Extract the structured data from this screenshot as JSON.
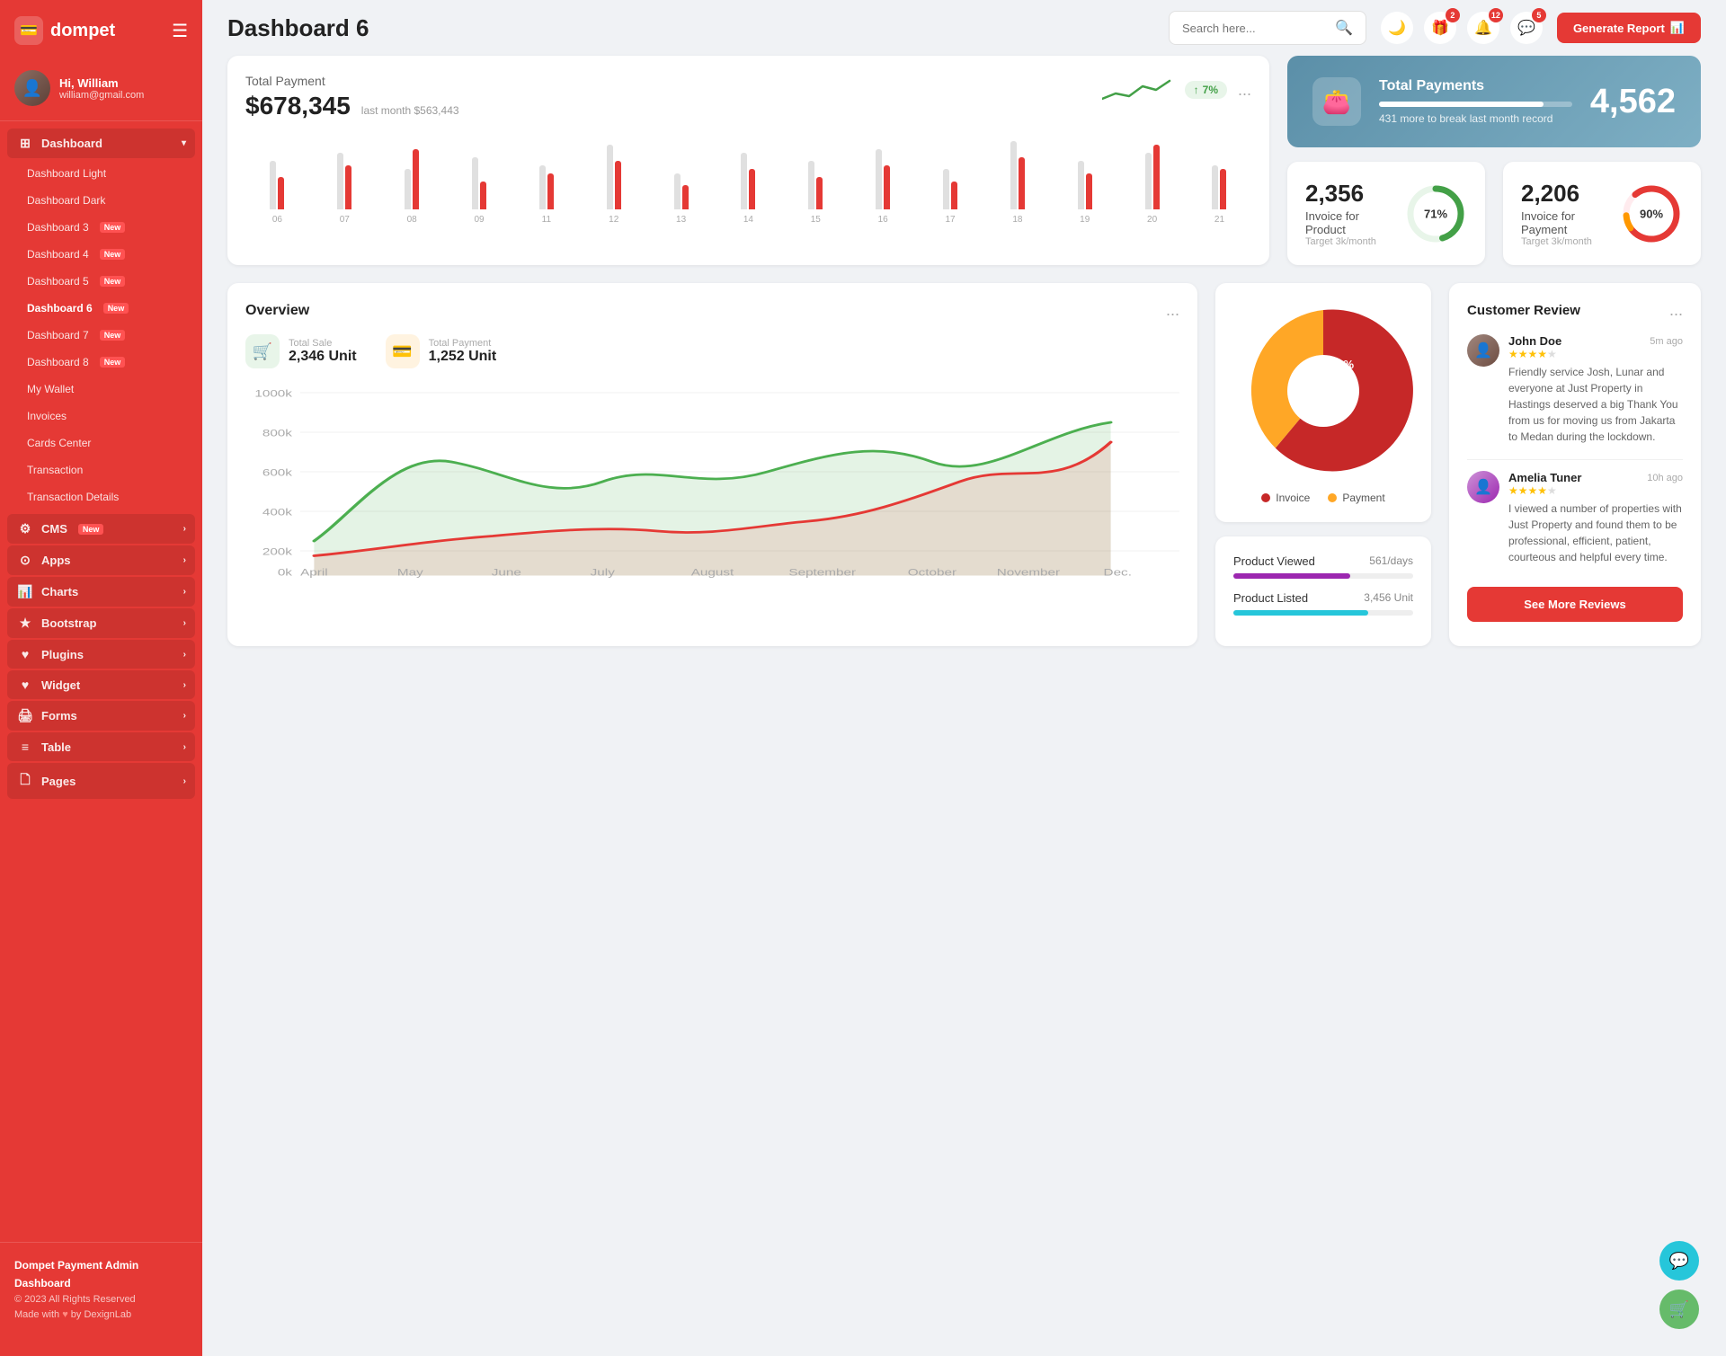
{
  "sidebar": {
    "logo": "dompet",
    "user": {
      "greeting": "Hi, William",
      "email": "william@gmail.com"
    },
    "nav": {
      "dashboard_label": "Dashboard",
      "items": [
        {
          "label": "Dashboard Light",
          "active": false,
          "new": false
        },
        {
          "label": "Dashboard Dark",
          "active": false,
          "new": false
        },
        {
          "label": "Dashboard 3",
          "active": false,
          "new": true
        },
        {
          "label": "Dashboard 4",
          "active": false,
          "new": true
        },
        {
          "label": "Dashboard 5",
          "active": false,
          "new": true
        },
        {
          "label": "Dashboard 6",
          "active": true,
          "new": true
        },
        {
          "label": "Dashboard 7",
          "active": false,
          "new": true
        },
        {
          "label": "Dashboard 8",
          "active": false,
          "new": true
        },
        {
          "label": "My Wallet",
          "active": false,
          "new": false
        },
        {
          "label": "Invoices",
          "active": false,
          "new": false
        },
        {
          "label": "Cards Center",
          "active": false,
          "new": false
        },
        {
          "label": "Transaction",
          "active": false,
          "new": false
        },
        {
          "label": "Transaction Details",
          "active": false,
          "new": false
        }
      ],
      "sections": [
        {
          "label": "CMS",
          "new": true,
          "arrow": true
        },
        {
          "label": "Apps",
          "new": false,
          "arrow": true
        },
        {
          "label": "Charts",
          "new": false,
          "arrow": true
        },
        {
          "label": "Bootstrap",
          "new": false,
          "arrow": true
        },
        {
          "label": "Plugins",
          "new": false,
          "arrow": true
        },
        {
          "label": "Widget",
          "new": false,
          "arrow": true
        },
        {
          "label": "Forms",
          "new": false,
          "arrow": true
        },
        {
          "label": "Table",
          "new": false,
          "arrow": true
        },
        {
          "label": "Pages",
          "new": false,
          "arrow": true
        }
      ]
    },
    "footer": {
      "brand": "Dompet Payment Admin Dashboard",
      "copyright": "© 2023 All Rights Reserved",
      "made_with": "Made with",
      "by": "by DexignLab"
    }
  },
  "topnav": {
    "page_title": "Dashboard 6",
    "search_placeholder": "Search here...",
    "badges": {
      "gift": "2",
      "bell": "12",
      "chat": "5"
    },
    "generate_btn": "Generate Report"
  },
  "total_payment": {
    "title": "Total Payment",
    "amount": "$678,345",
    "last_month_label": "last month $563,443",
    "trend": "7%",
    "dots": "...",
    "bars": [
      {
        "label": "06",
        "gray": 60,
        "red": 40
      },
      {
        "label": "07",
        "gray": 70,
        "red": 55
      },
      {
        "label": "08",
        "gray": 50,
        "red": 75
      },
      {
        "label": "09",
        "gray": 65,
        "red": 35
      },
      {
        "label": "11",
        "gray": 55,
        "red": 45
      },
      {
        "label": "12",
        "gray": 80,
        "red": 60
      },
      {
        "label": "13",
        "gray": 45,
        "red": 30
      },
      {
        "label": "14",
        "gray": 70,
        "red": 50
      },
      {
        "label": "15",
        "gray": 60,
        "red": 40
      },
      {
        "label": "16",
        "gray": 75,
        "red": 55
      },
      {
        "label": "17",
        "gray": 50,
        "red": 35
      },
      {
        "label": "18",
        "gray": 85,
        "red": 65
      },
      {
        "label": "19",
        "gray": 60,
        "red": 45
      },
      {
        "label": "20",
        "gray": 70,
        "red": 80
      },
      {
        "label": "21",
        "gray": 55,
        "red": 50
      }
    ]
  },
  "total_payments_banner": {
    "title": "Total Payments",
    "sub": "431 more to break last month record",
    "number": "4,562",
    "progress_pct": 85
  },
  "invoice_product": {
    "number": "2,356",
    "label": "Invoice for Product",
    "target": "Target 3k/month",
    "pct": 71,
    "color": "#43a047"
  },
  "invoice_payment": {
    "number": "2,206",
    "label": "Invoice for Payment",
    "target": "Target 3k/month",
    "pct": 90,
    "color": "#e53935"
  },
  "overview": {
    "title": "Overview",
    "total_sale_label": "Total Sale",
    "total_sale_value": "2,346 Unit",
    "total_payment_label": "Total Payment",
    "total_payment_value": "1,252 Unit",
    "dots": "...",
    "months": [
      "April",
      "May",
      "June",
      "July",
      "August",
      "September",
      "October",
      "November",
      "Dec."
    ],
    "y_labels": [
      "1000k",
      "800k",
      "600k",
      "400k",
      "200k",
      "0k"
    ]
  },
  "pie_chart": {
    "invoice_pct": "62%",
    "payment_pct": "38%",
    "invoice_color": "#c62828",
    "payment_color": "#ffa726",
    "invoice_label": "Invoice",
    "payment_label": "Payment"
  },
  "product_stats": {
    "viewed_label": "Product Viewed",
    "viewed_value": "561/days",
    "viewed_color": "#9c27b0",
    "viewed_pct": 65,
    "listed_label": "Product Listed",
    "listed_value": "3,456 Unit",
    "listed_color": "#26c6da",
    "listed_pct": 75
  },
  "customer_review": {
    "title": "Customer Review",
    "dots": "...",
    "reviews": [
      {
        "name": "John Doe",
        "stars": 4,
        "time": "5m ago",
        "text": "Friendly service Josh, Lunar and everyone at Just Property in Hastings deserved a big Thank You from us for moving us from Jakarta to Medan during the lockdown."
      },
      {
        "name": "Amelia Tuner",
        "stars": 4,
        "time": "10h ago",
        "text": "I viewed a number of properties with Just Property and found them to be professional, efficient, patient, courteous and helpful every time."
      }
    ],
    "see_more_btn": "See More Reviews"
  },
  "fab": {
    "support_icon": "💬",
    "cart_icon": "🛒"
  }
}
